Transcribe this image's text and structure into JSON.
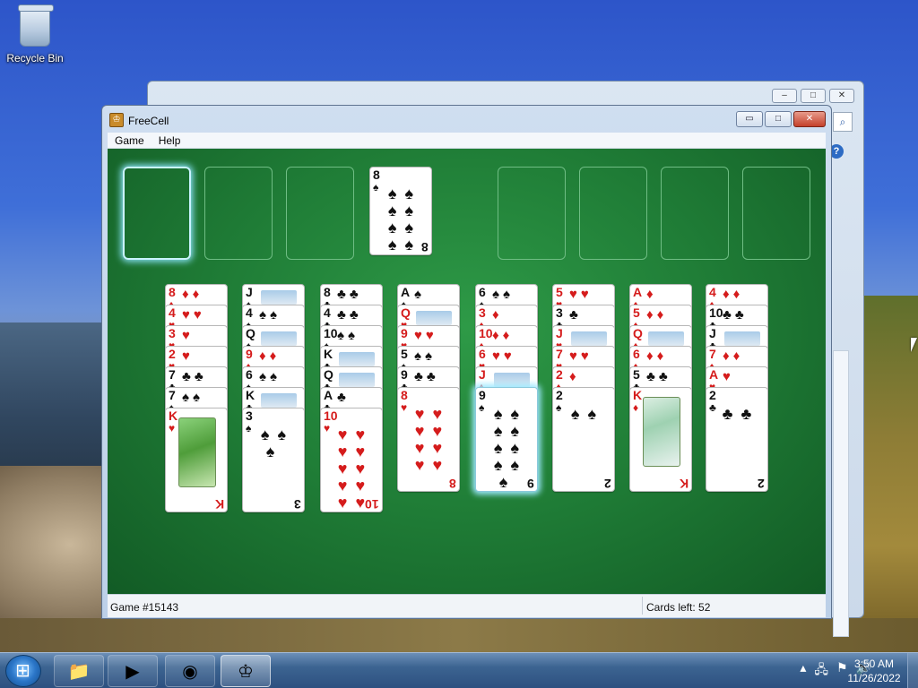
{
  "desktop": {
    "recycle_bin_label": "Recycle Bin"
  },
  "window": {
    "title": "FreeCell",
    "menu": [
      "Game",
      "Help"
    ],
    "minimize_label": "▭",
    "maximize_label": "□",
    "close_label": "✕"
  },
  "status": {
    "game": "Game #15143",
    "cards_left": "Cards left: 52"
  },
  "free_cells": [
    {
      "card": null,
      "selected": true
    },
    {
      "card": null
    },
    {
      "card": null
    },
    {
      "card": {
        "rank": "8",
        "suit": "♠",
        "color": "black"
      }
    }
  ],
  "foundations": [
    null,
    null,
    null,
    null
  ],
  "tableau": [
    [
      [
        "8",
        "♦",
        "red"
      ],
      [
        "4",
        "♥",
        "red"
      ],
      [
        "3",
        "♥",
        "red"
      ],
      [
        "2",
        "♥",
        "red"
      ],
      [
        "7",
        "♣",
        "black"
      ],
      [
        "7",
        "♠",
        "black"
      ],
      [
        "K",
        "♥",
        "red"
      ]
    ],
    [
      [
        "J",
        "♠",
        "black"
      ],
      [
        "4",
        "♠",
        "black"
      ],
      [
        "Q",
        "♠",
        "black"
      ],
      [
        "9",
        "♦",
        "red"
      ],
      [
        "6",
        "♠",
        "black"
      ],
      [
        "K",
        "♣",
        "black"
      ],
      [
        "3",
        "♠",
        "black"
      ]
    ],
    [
      [
        "8",
        "♣",
        "black"
      ],
      [
        "4",
        "♣",
        "black"
      ],
      [
        "10",
        "♠",
        "black"
      ],
      [
        "K",
        "♣",
        "black"
      ],
      [
        "Q",
        "♣",
        "black"
      ],
      [
        "A",
        "♣",
        "black"
      ],
      [
        "10",
        "♥",
        "red"
      ]
    ],
    [
      [
        "A",
        "♠",
        "black"
      ],
      [
        "Q",
        "♥",
        "red"
      ],
      [
        "9",
        "♥",
        "red"
      ],
      [
        "5",
        "♠",
        "black"
      ],
      [
        "9",
        "♣",
        "black"
      ],
      [
        "8",
        "♥",
        "red"
      ]
    ],
    [
      [
        "6",
        "♠",
        "black"
      ],
      [
        "3",
        "♦",
        "red"
      ],
      [
        "10",
        "♦",
        "red"
      ],
      [
        "6",
        "♥",
        "red"
      ],
      [
        "J",
        "♦",
        "red"
      ],
      [
        "9",
        "♠",
        "black"
      ]
    ],
    [
      [
        "5",
        "♥",
        "red"
      ],
      [
        "3",
        "♣",
        "black"
      ],
      [
        "J",
        "♥",
        "red"
      ],
      [
        "7",
        "♥",
        "red"
      ],
      [
        "2",
        "♦",
        "red"
      ],
      [
        "2",
        "♠",
        "black"
      ]
    ],
    [
      [
        "A",
        "♦",
        "red"
      ],
      [
        "5",
        "♦",
        "red"
      ],
      [
        "Q",
        "♦",
        "red"
      ],
      [
        "6",
        "♦",
        "red"
      ],
      [
        "5",
        "♣",
        "black"
      ],
      [
        "K",
        "♦",
        "red"
      ]
    ],
    [
      [
        "4",
        "♦",
        "red"
      ],
      [
        "10",
        "♣",
        "black"
      ],
      [
        "J",
        "♣",
        "black"
      ],
      [
        "7",
        "♦",
        "red"
      ],
      [
        "A",
        "♥",
        "red"
      ],
      [
        "2",
        "♣",
        "black"
      ]
    ]
  ],
  "taskbar": {
    "apps": [
      "explorer",
      "media-player",
      "chrome",
      "freecell"
    ],
    "time": "3:50 AM",
    "date": "11/26/2022"
  },
  "colors": {
    "felt": "#1f7c36",
    "red_suit": "#d51c1c",
    "black_suit": "#111111"
  }
}
